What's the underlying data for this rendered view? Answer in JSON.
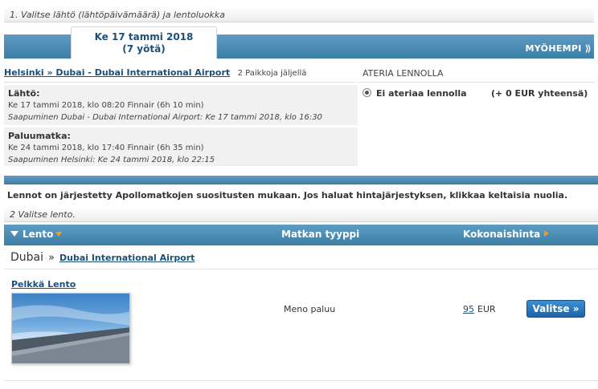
{
  "step1": {
    "label": "1. Valitse lähtö (lähtöpäivämäärä) ja lentoluokka"
  },
  "date_tabs": {
    "selected_day": "Ke 17 tammi 2018",
    "selected_nights": "(7 yötä)",
    "later_label": "MYÖHEMPI ⟫"
  },
  "route": {
    "link": "Helsinki » Dubai - Dubai International Airport",
    "seats": "2 Paikkoja jäljellä"
  },
  "outbound": {
    "label": "Lähtö:",
    "details": "Ke 17 tammi 2018, klo 08:20 Finnair (6h 10 min)",
    "arrival": "Saapuminen Dubai - Dubai International Airport: Ke 17 tammi 2018, klo 16:30"
  },
  "return": {
    "label": "Paluumatka:",
    "details": "Ke 24 tammi 2018, klo 17:40 Finnair (6h 35 min)",
    "arrival": "Saapuminen Helsinki: Ke 24 tammi 2018, klo 22:15"
  },
  "meal": {
    "title": "ATERIA LENNOLLA",
    "option": "Ei ateriaa lennolla",
    "price": "(+ 0 EUR yhteensä)"
  },
  "info": "Lennot on järjestetty Apollomatkojen suositusten mukaan. Jos haluat hintajärjestyksen, klikkaa keltaisia nuolia.",
  "step2": {
    "label": "2 Valitse lento."
  },
  "columns": {
    "flight": "Lento",
    "trip_type": "Matkan tyyppi",
    "total_price": "Kokonaishinta"
  },
  "destination": {
    "city": "Dubai",
    "separator": "»",
    "airport": "Dubai International Airport"
  },
  "offer": {
    "name": "Pelkkä Lento",
    "trip_type": "Meno paluu",
    "price": "95",
    "currency": "EUR",
    "select_label": "Valitse »"
  },
  "colors": {
    "bar_blue": "#4a8ab3",
    "link_blue": "#1a4f7a",
    "sort_arrow": "#f39b1e"
  }
}
